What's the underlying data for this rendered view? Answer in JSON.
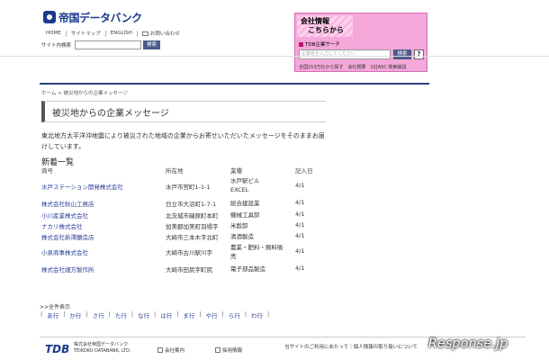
{
  "header": {
    "logo_text": "帝国データバンク",
    "nav": [
      "HOME",
      "サイトマップ",
      "ENGLISH",
      "お問い合わせ"
    ],
    "site_search_label": "サイト内検索",
    "site_search_button": "検索"
  },
  "company_box": {
    "title_line1": "会社情報",
    "title_line2": "こちらから",
    "subtitle": "TDB企業サーチ",
    "input_placeholder": "企業名を入力してください",
    "search_button": "検索",
    "help": "?",
    "links": "全国153万社から探す　会社概要　1社ASC 検索解説"
  },
  "breadcrumb": "ホーム > 被災地からの企業メッセージ",
  "page_title": "被災地からの企業メッセージ",
  "intro": "東北地方太平洋沖地震により被災された地域の企業からお寄せいただいたメッセージをそのままお届けしています。",
  "section_heading": "新着一覧",
  "table": {
    "headers": [
      "商号",
      "所在地",
      "業種",
      "記入日"
    ],
    "rows": [
      {
        "name": "水戸ステーション開発株式会社",
        "location": "水戸市宮町1-1-1",
        "industry": "水戸駅ビル\nEXCEL",
        "date": "4/1"
      },
      {
        "name": "株式会社秋山工務店",
        "location": "日立市大沼町1-7-1",
        "industry": "総合建設業",
        "date": "4/1"
      },
      {
        "name": "小川産業株式会社",
        "location": "北茨城市磯原町本町",
        "industry": "機械工具卸",
        "date": "4/1"
      },
      {
        "name": "ナカリ株式会社",
        "location": "加美郡加美町羽場字",
        "industry": "米穀卸",
        "date": "4/1"
      },
      {
        "name": "株式会社新澤醸造店",
        "location": "大崎市三本木字北町",
        "industry": "清酒製造",
        "date": "4/1"
      },
      {
        "name": "小泉商事株式会社",
        "location": "大崎市古川駅川字",
        "industry": "農業・肥料・飼料販\n売",
        "date": "4/1"
      },
      {
        "name": "株式会社細方製作所",
        "location": "大崎市田尻字町尻",
        "industry": "電子部品製造",
        "date": "4/1"
      }
    ]
  },
  "more_link": ">>全件表示",
  "kana_index": [
    "あ行",
    "か行",
    "さ行",
    "た行",
    "な行",
    "は行",
    "ま行",
    "や行",
    "ら行",
    "わ行"
  ],
  "footer": {
    "logo": "TDB",
    "company_line1": "株式会社帝国データバンク",
    "company_line2": "TEIKOKU DATABANK, LTD.",
    "btn_company": "会社案内",
    "btn_recruit": "採用情報",
    "links": "当サイトのご利用にあたって｜個人情報の取り扱いについて"
  },
  "watermark": "Response.jp"
}
